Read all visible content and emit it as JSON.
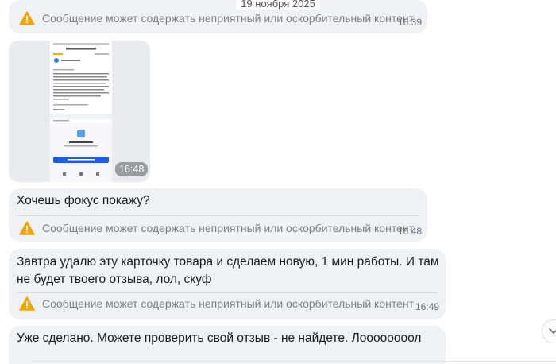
{
  "date_divider": "19 ноября 2025",
  "warning_text": "Сообщение может содержать неприятный или оскорбительный контент",
  "messages": [
    {
      "time": "16:39"
    },
    {
      "time": "16:48",
      "type": "image"
    },
    {
      "text": "Хочешь фокус покажу?",
      "time": "16:48"
    },
    {
      "text_line1": "Завтра удалю эту карточку товара и сделаем новую, 1 мин работы. И там",
      "text_line2": "не будет твоего отзыва, лол, скуф",
      "time": "16:49"
    },
    {
      "text": "Уже сделано. Можете проверить свой отзыв - не найдете. Лоооооооол"
    }
  ],
  "colors": {
    "bubble": "#f0f1f4",
    "warning": "#f0a500",
    "accent": "#1a73e8"
  },
  "icons": {
    "warning": "warning-icon",
    "scroll": "chevron-down-icon"
  }
}
